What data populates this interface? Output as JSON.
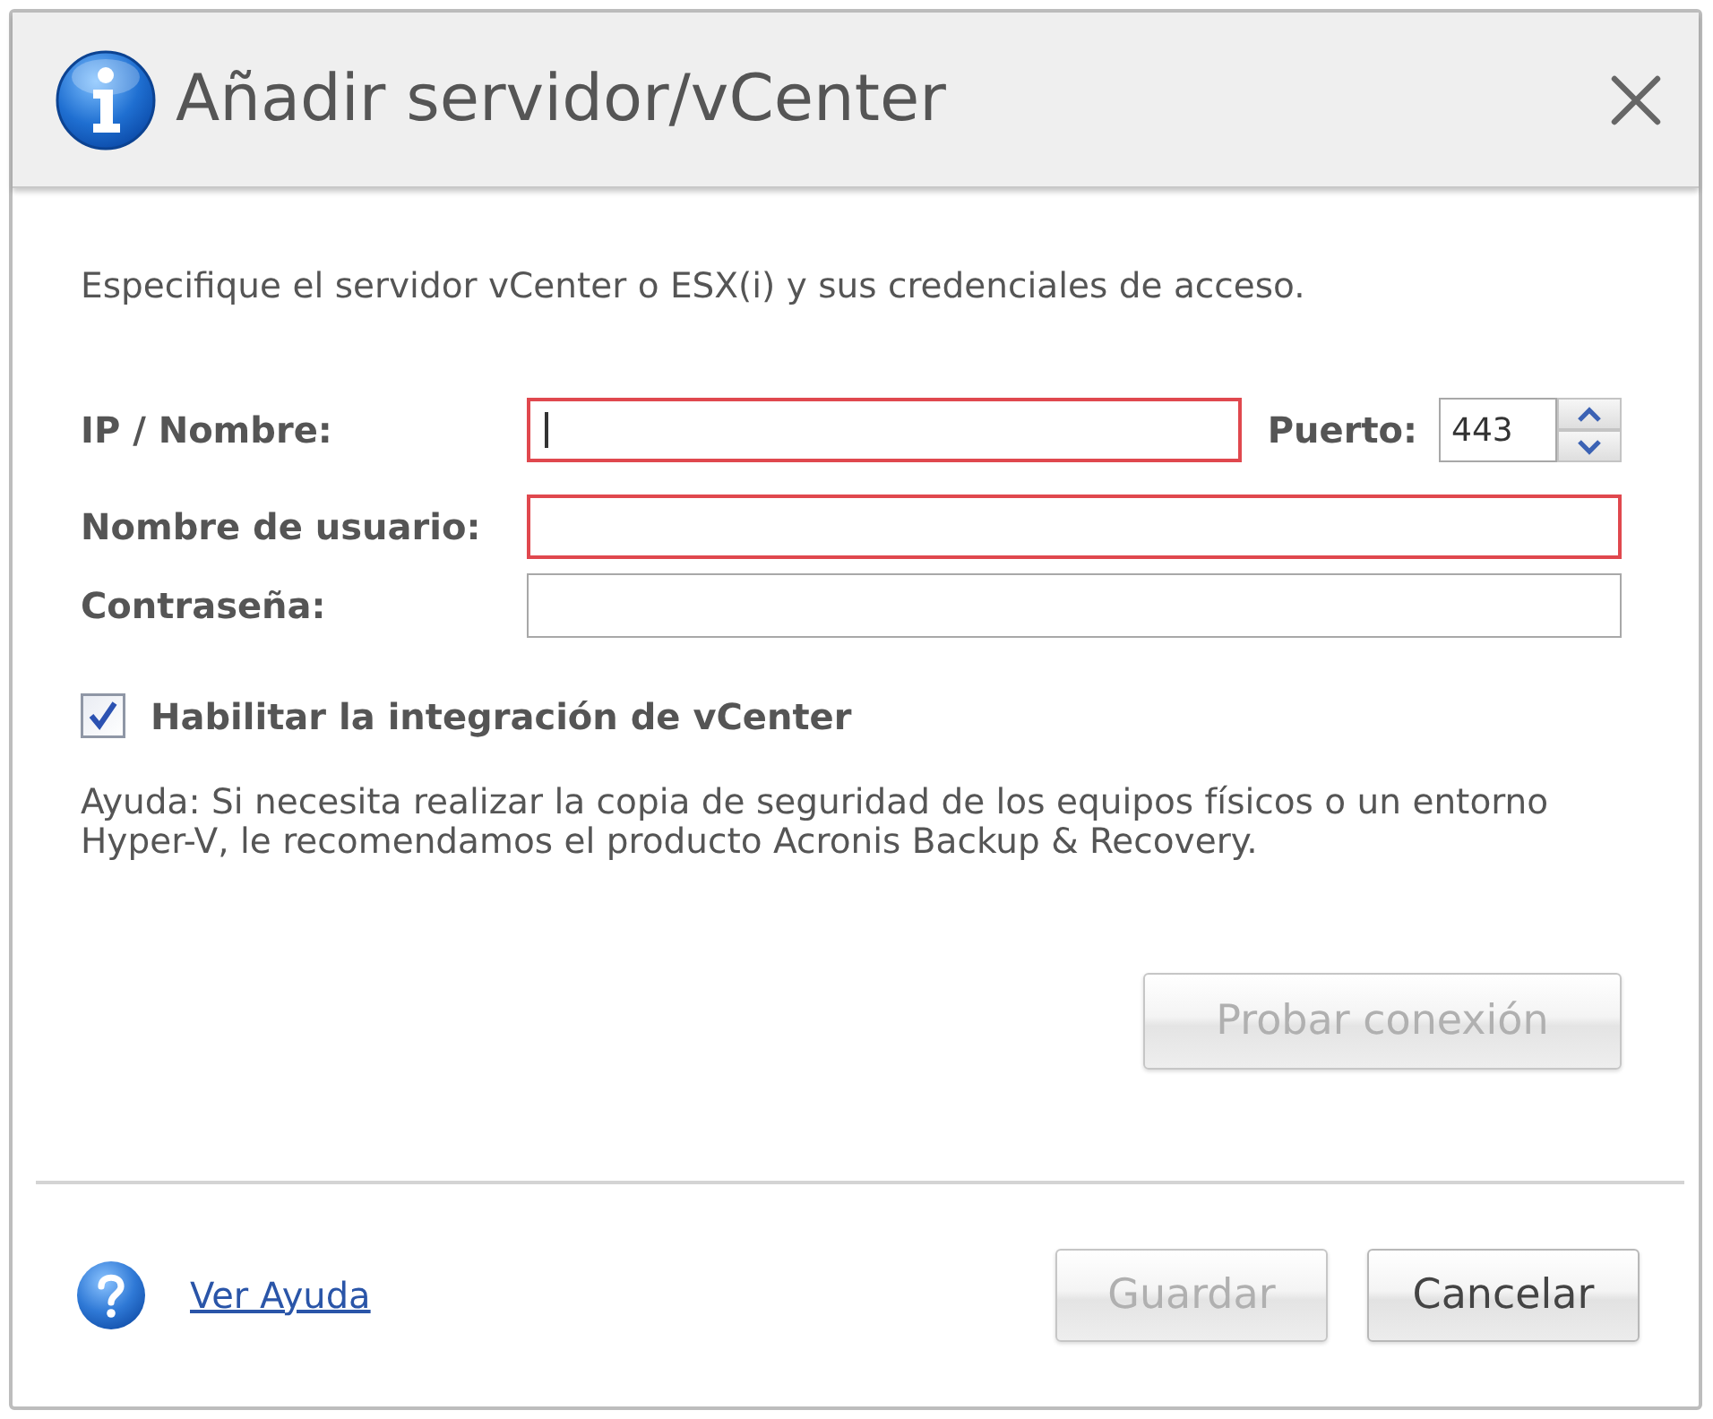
{
  "window": {
    "title": "Añadir servidor/vCenter"
  },
  "description": "Especifique el servidor vCenter o ESX(i) y sus credenciales de acceso.",
  "fields": [
    {
      "label": "IP / Nombre:",
      "invalid": true,
      "focused": true,
      "port": {
        "label": "Puerto:",
        "value": "443"
      }
    },
    {
      "label": "Nombre de usuario:",
      "invalid": true,
      "focused": false
    },
    {
      "label": "Contraseña:",
      "invalid": false,
      "focused": false
    }
  ],
  "vcenter_integration": {
    "label": "Habilitar la integración de vCenter",
    "checked": true
  },
  "help_text": "Ayuda: Si necesita realizar la copia de seguridad de los equipos físicos o un entorno Hyper-V, le recomendamos el producto Acronis Backup & Recovery.",
  "test_button": {
    "label": "Probar conexión",
    "disabled": true
  },
  "footer": {
    "help_link": "Ver Ayuda",
    "buttons": [
      {
        "label": "Guardar",
        "disabled": true
      },
      {
        "label": "Cancelar",
        "disabled": false
      }
    ]
  }
}
